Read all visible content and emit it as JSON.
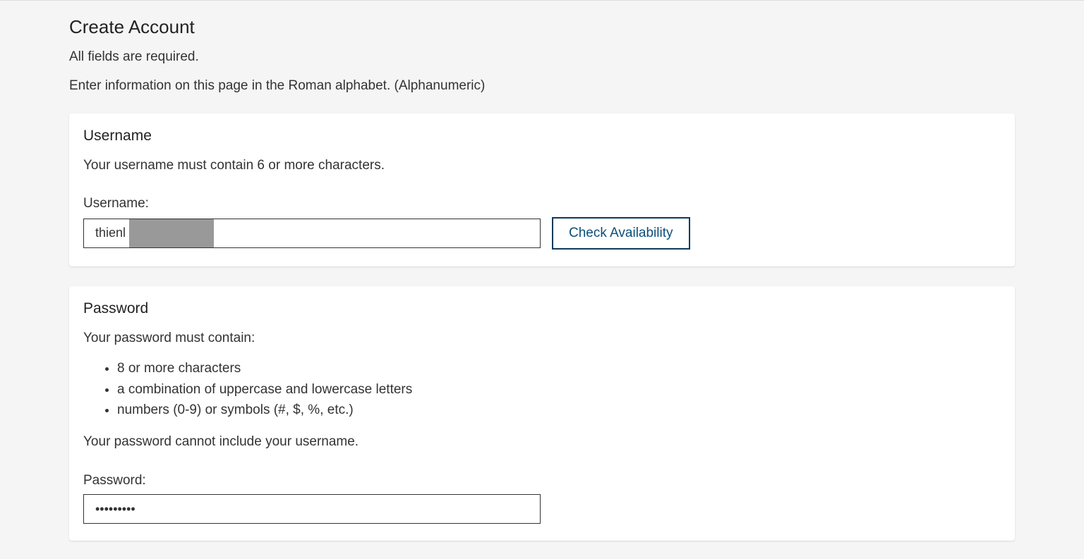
{
  "page": {
    "title": "Create Account",
    "intro1": "All fields are required.",
    "intro2": "Enter information on this page in the Roman alphabet. (Alphanumeric)"
  },
  "username": {
    "section_title": "Username",
    "help": "Your username must contain 6 or more characters.",
    "label": "Username:",
    "value": "thienl",
    "check_button": "Check Availability"
  },
  "password": {
    "section_title": "Password",
    "help_intro": "Your password must contain:",
    "requirements": [
      "8 or more characters",
      "a combination of uppercase and lowercase letters",
      "numbers (0-9) or symbols (#, $, %, etc.)"
    ],
    "post_note": "Your password cannot include your username.",
    "label": "Password:",
    "value": "•••••••••"
  }
}
